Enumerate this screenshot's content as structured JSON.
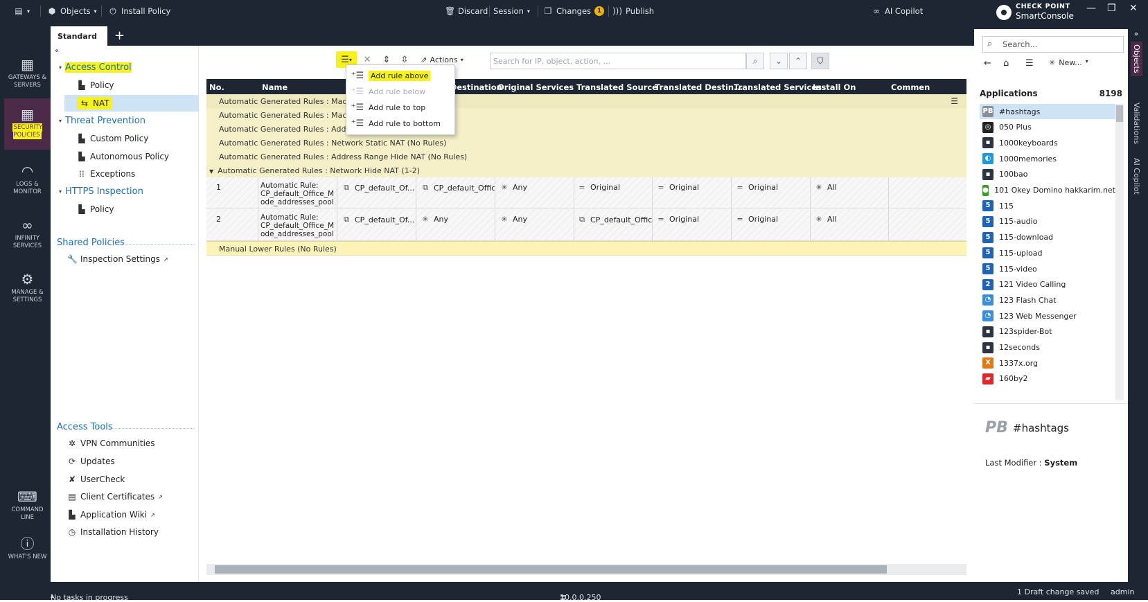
{
  "topbar": {
    "objects_label": "Objects",
    "install_policy_label": "Install Policy",
    "discard_label": "Discard",
    "session_label": "Session",
    "changes_label": "Changes",
    "changes_count": "1",
    "publish_label": "Publish",
    "ai_copilot_label": "AI Copilot",
    "brand_top": "CHECK POINT",
    "brand_bottom": "SmartConsole"
  },
  "leftnav": [
    {
      "label": "GATEWAYS & SERVERS",
      "icon": "gateways-icon"
    },
    {
      "label": "SECURITY POLICIES",
      "icon": "security-policies-icon"
    },
    {
      "label": "LOGS & MONITOR",
      "icon": "logs-icon"
    },
    {
      "label": "INFINITY SERVICES",
      "icon": "infinity-icon"
    },
    {
      "label": "MANAGE & SETTINGS",
      "icon": "gear-icon"
    },
    {
      "label": "COMMAND LINE",
      "icon": "command-line-icon"
    },
    {
      "label": "WHAT'S NEW",
      "icon": "question-icon"
    }
  ],
  "tabs": {
    "active": "Standard"
  },
  "tree": {
    "access_control": "Access Control",
    "policy": "Policy",
    "nat": "NAT",
    "threat_prevention": "Threat Prevention",
    "custom_policy": "Custom Policy",
    "autonomous_policy": "Autonomous Policy",
    "exceptions": "Exceptions",
    "https_inspection": "HTTPS Inspection",
    "https_policy": "Policy",
    "shared_policies": "Shared Policies",
    "inspection_settings": "Inspection Settings",
    "access_tools": "Access Tools",
    "vpn_communities": "VPN Communities",
    "updates": "Updates",
    "usercheck": "UserCheck",
    "client_certificates": "Client Certificates",
    "application_wiki": "Application Wiki",
    "installation_history": "Installation History"
  },
  "toolbar": {
    "actions_label": "Actions",
    "search_placeholder": "Search for IP, object, action, ..."
  },
  "menu": {
    "add_above": "Add rule above",
    "add_below": "Add rule below",
    "add_top": "Add rule to top",
    "add_bottom": "Add rule to bottom"
  },
  "grid": {
    "headers": [
      "No.",
      "Name",
      "al Destination",
      "Original Services",
      "Translated Source",
      "Translated Destin...",
      "Translated Services",
      "Install On",
      "Commen"
    ],
    "groups": [
      "Automatic Generated Rules : Machi",
      "Automatic Generated Rules : Machi",
      "Automatic Generated Rules : Addre",
      "Automatic Generated Rules : Network Static NAT",
      "Automatic Generated Rules : Address Range Hide NAT",
      "Automatic Generated Rules : Network Hide NAT"
    ],
    "group_suffix": [
      "",
      "",
      "",
      "(No Rules)",
      "(No Rules)",
      "(1-2)"
    ],
    "rows": [
      {
        "no": "1",
        "name": "Automatic Rule: CP_default_Office_Mode_addresses_pool",
        "orig_src": "CP_default_Of...",
        "orig_dst": "CP_default_Offic",
        "orig_svc": "Any",
        "tr_src": "Original",
        "tr_dst": "Original",
        "tr_svc": "Original",
        "install_on": "All"
      },
      {
        "no": "2",
        "name": "Automatic Rule: CP_default_Office_Mode_addresses_pool",
        "orig_src": "CP_default_Of...",
        "orig_dst": "Any",
        "orig_svc": "Any",
        "tr_src": "CP_default_Offic",
        "tr_dst": "Original",
        "tr_svc": "Original",
        "install_on": "All"
      }
    ],
    "name_lines": [
      "Automatic Rule:",
      "CP_default_Office_M",
      "ode_addresses_pool"
    ],
    "lower": "Manual Lower Rules",
    "lower_suffix": "(No Rules)"
  },
  "rightpane": {
    "search_placeholder": "Search...",
    "new_label": "New...",
    "section": "Applications",
    "count": "8198",
    "apps": [
      {
        "name": "#hashtags",
        "icon": "PB",
        "color": "#8a8f96"
      },
      {
        "name": "050 Plus",
        "icon": "◎",
        "color": "#222"
      },
      {
        "name": "1000keyboards",
        "icon": "▪",
        "color": "#2b3440"
      },
      {
        "name": "1000memories",
        "icon": "◐",
        "color": "#1f9ad6"
      },
      {
        "name": "100bao",
        "icon": "▪",
        "color": "#2b3440"
      },
      {
        "name": "101 Okey Domino hakkarim.net",
        "icon": "●",
        "color": "#3a9a2a"
      },
      {
        "name": "115",
        "icon": "5",
        "color": "#1e63b7"
      },
      {
        "name": "115-audio",
        "icon": "5",
        "color": "#1e63b7"
      },
      {
        "name": "115-download",
        "icon": "5",
        "color": "#1e63b7"
      },
      {
        "name": "115-upload",
        "icon": "5",
        "color": "#1e63b7"
      },
      {
        "name": "115-video",
        "icon": "5",
        "color": "#1e63b7"
      },
      {
        "name": "121 Video Calling",
        "icon": "2",
        "color": "#1e63b7"
      },
      {
        "name": "123 Flash Chat",
        "icon": "◔",
        "color": "#3b8fd8"
      },
      {
        "name": "123 Web Messenger",
        "icon": "◔",
        "color": "#3b8fd8"
      },
      {
        "name": "123spider-Bot",
        "icon": "▪",
        "color": "#2b3440"
      },
      {
        "name": "12seconds",
        "icon": "▪",
        "color": "#2b3440"
      },
      {
        "name": "1337x.org",
        "icon": "X",
        "color": "#e07a10"
      },
      {
        "name": "160by2",
        "icon": "▰",
        "color": "#e3262b"
      }
    ],
    "detail_icon": "PB",
    "detail_title": "#hashtags",
    "last_modifier_label": "Last Modifier :",
    "last_modifier_value": "System"
  },
  "vtabs": [
    "Objects",
    "Validations",
    "AI Copilot"
  ],
  "status": {
    "tasks": "No tasks in progress",
    "server": "10.0.0.250",
    "draft": "1 Draft change saved",
    "user": "admin"
  }
}
